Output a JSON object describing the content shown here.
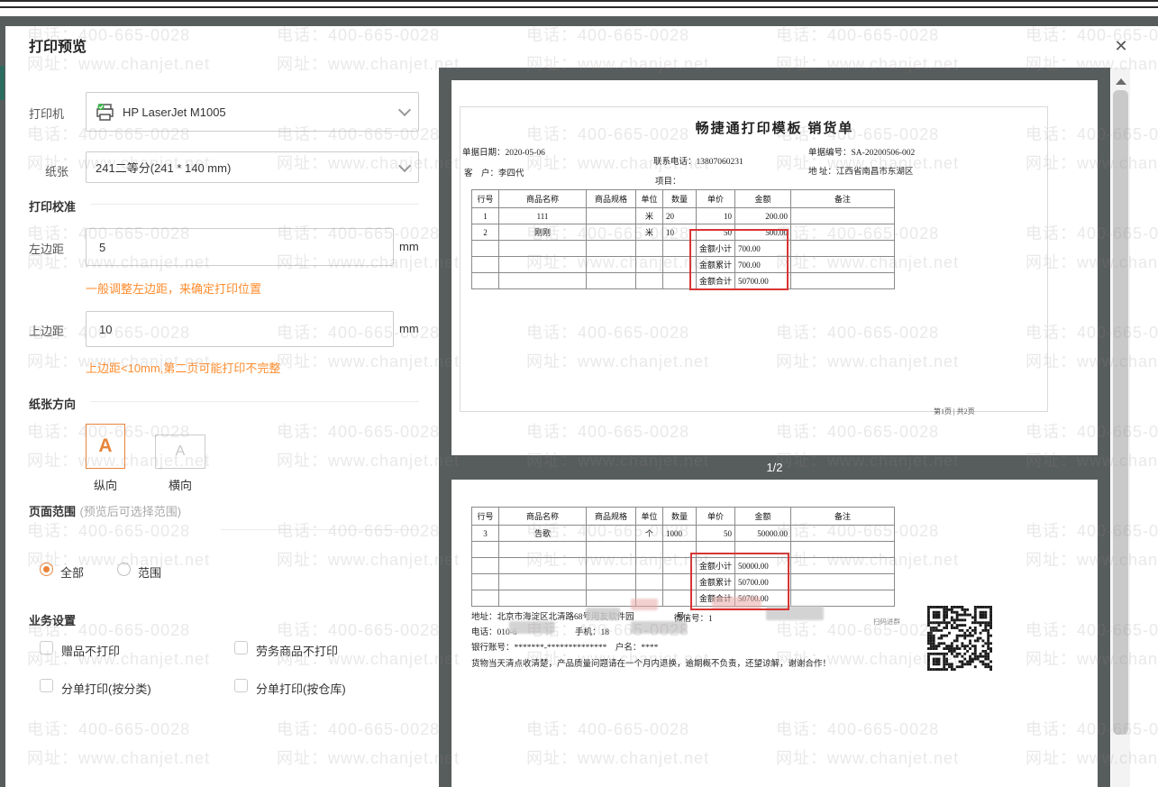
{
  "chrome": {
    "close_icon": "✕"
  },
  "watermark": {
    "phone": "电话：400-665-0028",
    "site": "网址：www.chanjet.net"
  },
  "panel": {
    "title": "打印预览",
    "printer_label": "打印机",
    "printer_value": "HP LaserJet M1005",
    "paper_label": "纸张",
    "paper_value": "241二等分(241 * 140 mm)",
    "calibration_title": "打印校准",
    "left_margin_label": "左边距",
    "left_margin_value": "5",
    "left_margin_unit": "mm",
    "left_margin_hint": "一般调整左边距，来确定打印位置",
    "top_margin_label": "上边距",
    "top_margin_value": "10",
    "top_margin_unit": "mm",
    "top_margin_hint": "上边距<10mm,第二页可能打印不完整",
    "orientation_title": "纸张方向",
    "orientation_glyph": "A",
    "portrait_label": "纵向",
    "landscape_label": "横向",
    "range_title": "页面范围",
    "range_note": "(预览后可选择范围)",
    "range_all": "全部",
    "range_custom": "范围",
    "business_title": "业务设置",
    "business_options": [
      "赠品不打印",
      "劳务商品不打印",
      "分单打印(按分类)",
      "分单打印(按仓库)"
    ]
  },
  "preview": {
    "page_indicator": "1/2",
    "doc_title": "畅捷通打印模板 销货单",
    "header": {
      "date_label": "单据日期：",
      "date": "2020-05-06",
      "customer_label": "客　户：",
      "customer": "李四代",
      "phone_label": "联系电话：",
      "phone": "13807060231",
      "project_label": "项目：",
      "no_label": "单据编号：",
      "no": "SA-20200506-002",
      "addr_label": "地 址：",
      "addr": "江西省南昌市东湖区"
    },
    "columns": [
      "行号",
      "商品名称",
      "商品规格",
      "单位",
      "数量",
      "单价",
      "金额",
      "备注"
    ],
    "page1": {
      "rows": [
        [
          "1",
          "111",
          "",
          "米",
          "20",
          "10",
          "200.00",
          ""
        ],
        [
          "2",
          "刚刚",
          "",
          "米",
          "10",
          "50",
          "500.00",
          ""
        ]
      ],
      "totals": [
        [
          "金额小计",
          "700.00"
        ],
        [
          "金额累计",
          "700.00"
        ],
        [
          "金额合计",
          "50700.00"
        ]
      ],
      "footer": "第1页 | 共2页"
    },
    "page2": {
      "rows": [
        [
          "3",
          "告歌",
          "",
          "个",
          "1000",
          "50",
          "50000.00",
          ""
        ],
        [
          "",
          "",
          "",
          "",
          "",
          "",
          "",
          ""
        ]
      ],
      "totals": [
        [
          "金额小计",
          "50000.00"
        ],
        [
          "金额累计",
          "50700.00"
        ],
        [
          "金额合计",
          "50700.00"
        ]
      ],
      "footer_lines": {
        "addr": "地址：北京市海淀区北清路68号用友软件园",
        "addr_suffix": "号，",
        "wechat": "微信号：1",
        "tel": "电话：010-6",
        "mobile": "手机：18",
        "bank": "银行账号：*******-**************　户名：****",
        "note": "货物当天清点收清楚，产品质量问题请在一个月内退换，逾期概不负责，还望谅解，谢谢合作！",
        "qr_caption": "扫码进群"
      }
    }
  }
}
